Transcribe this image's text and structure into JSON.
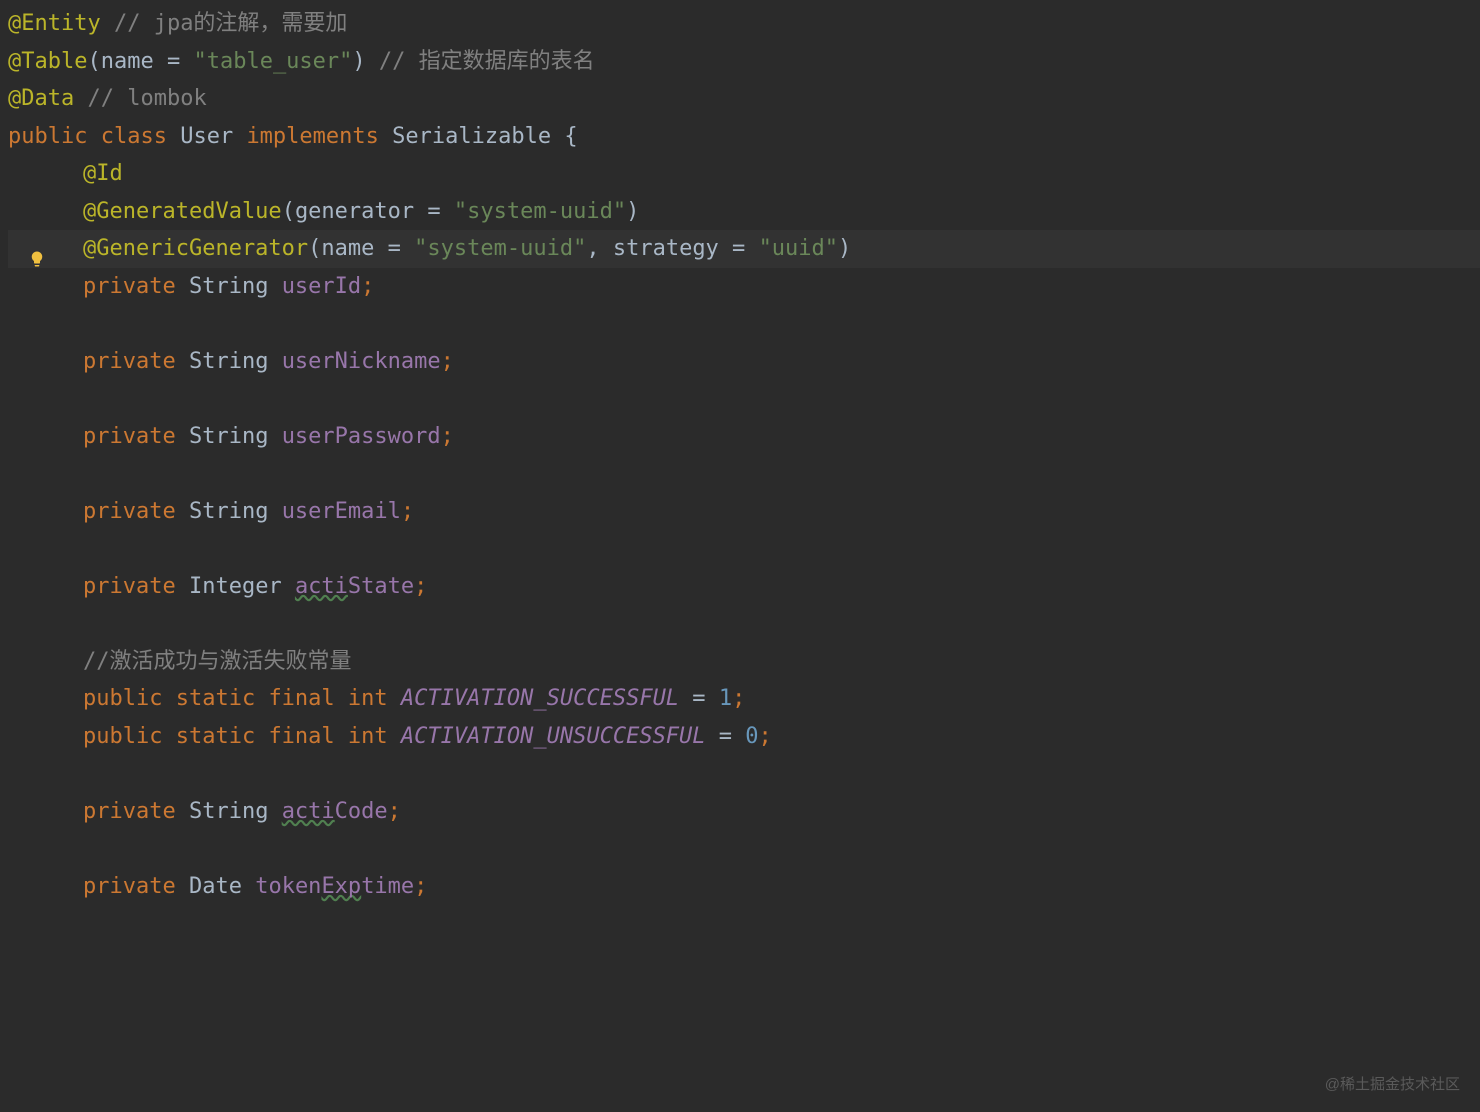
{
  "gutter": {
    "bulb_icon": "lightbulb-icon"
  },
  "code": {
    "line1": {
      "annotation": "@Entity",
      "comment": " // jpa的注解，需要加"
    },
    "line2": {
      "annotation": "@Table",
      "paren_open": "(",
      "param_name": "name",
      "eq": " = ",
      "value": "\"table_user\"",
      "paren_close": ")",
      "comment": " // 指定数据库的表名"
    },
    "line3": {
      "annotation": "@Data",
      "comment": " // lombok"
    },
    "line4": {
      "kw_public": "public ",
      "kw_class": "class ",
      "classname": "User ",
      "kw_implements": "implements ",
      "iface": "Serializable ",
      "brace": "{"
    },
    "line5": {
      "annotation": "@Id"
    },
    "line6": {
      "annotation": "@GeneratedValue",
      "paren_open": "(",
      "param": "generator",
      "eq": " = ",
      "value": "\"system-uuid\"",
      "paren_close": ")"
    },
    "line7": {
      "annotation": "@GenericGenerator",
      "paren_open": "(",
      "param1": "name",
      "eq1": " = ",
      "value1": "\"system-uuid\"",
      "comma": ", ",
      "param2": "strategy",
      "eq2": " = ",
      "value2": "\"uuid\"",
      "paren_close": ")"
    },
    "line8": {
      "kw": "private ",
      "type": "String ",
      "ident": "userId",
      "semi": ";"
    },
    "line10": {
      "kw": "private ",
      "type": "String ",
      "ident": "userNickname",
      "semi": ";"
    },
    "line12": {
      "kw": "private ",
      "type": "String ",
      "ident": "userPassword",
      "semi": ";"
    },
    "line14": {
      "kw": "private ",
      "type": "String ",
      "ident": "userEmail",
      "semi": ";"
    },
    "line16": {
      "kw": "private ",
      "type": "Integer ",
      "ident_pre": "acti",
      "ident_post": "State",
      "semi": ";"
    },
    "line18": {
      "comment": "//激活成功与激活失败常量"
    },
    "line19": {
      "kw1": "public ",
      "kw2": "static ",
      "kw3": "final ",
      "kw4": "int ",
      "ident": "ACTIVATION_SUCCESSFUL",
      "eq": " = ",
      "num": "1",
      "semi": ";"
    },
    "line20": {
      "kw1": "public ",
      "kw2": "static ",
      "kw3": "final ",
      "kw4": "int ",
      "ident": "ACTIVATION_UNSUCCESSFUL",
      "eq": " = ",
      "num": "0",
      "semi": ";"
    },
    "line22": {
      "kw": "private ",
      "type": "String ",
      "ident_pre": "acti",
      "ident_post": "Code",
      "semi": ";"
    },
    "line24": {
      "kw": "private ",
      "type": "Date ",
      "ident_pre": "token",
      "ident_mid": "Exp",
      "ident_post": "time",
      "semi": ";"
    }
  },
  "watermark": "@稀土掘金技术社区"
}
